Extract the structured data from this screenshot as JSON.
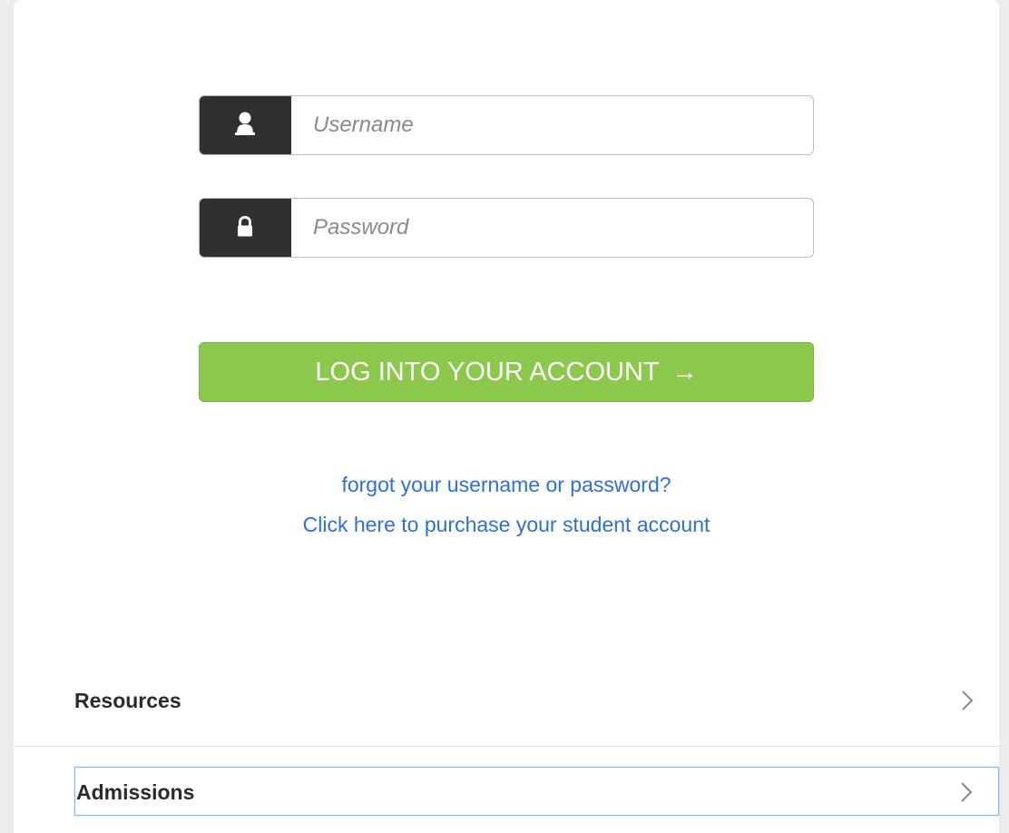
{
  "login_form": {
    "username": {
      "placeholder": "Username",
      "value": "",
      "icon": "user-icon"
    },
    "password": {
      "placeholder": "Password",
      "value": "",
      "icon": "lock-icon"
    },
    "submit_label": "LOG INTO YOUR ACCOUNT",
    "submit_arrow": "→",
    "forgot_link": "forgot your username or password?",
    "purchase_link": "Click here to purchase your student account"
  },
  "nav": {
    "items": [
      {
        "label": "Resources",
        "icon": "chevron-right-icon"
      },
      {
        "label": "Admissions",
        "icon": "chevron-right-icon"
      }
    ]
  },
  "colors": {
    "accent_button": "#8cc84b",
    "addon_dark": "#303030",
    "link": "#2f6fd8",
    "background": "#ececec",
    "card": "#ffffff"
  }
}
